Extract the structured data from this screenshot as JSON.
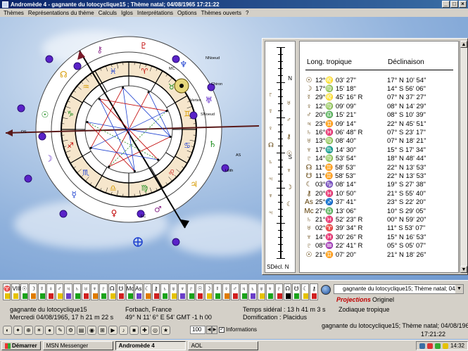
{
  "window": {
    "title": "Andromède 4 - gagnante du lotocyclique15 ; Thème natal; 04/08/1965 17:21:22",
    "buttons": [
      "_",
      "□",
      "×"
    ]
  },
  "menu": [
    "Thèmes",
    "Représentations du thème",
    "Calculs",
    "Iglos",
    "Interprétations",
    "Options",
    "Thèmes ouverts",
    "?"
  ],
  "colors": {
    "accent": "#0a246a",
    "red": "#c00000",
    "blue": "#1c3fd0",
    "purple": "#5a22c8",
    "ink": "#5a3a00"
  },
  "wheel": {
    "chart_labels": [
      "MC",
      "AS",
      "DS",
      "FC",
      "NNoeud",
      "Chiron",
      "Vertex",
      "SNoeud",
      "Lilith"
    ],
    "signs_symbols": [
      "♈",
      "♉",
      "♊",
      "♋",
      "♌",
      "♍",
      "♎",
      "♏",
      "♐",
      "♑",
      "♒",
      "♓"
    ],
    "outer_planets": [
      "♇",
      "♆",
      "♅",
      "♄",
      "♃",
      "♂",
      "♀",
      "☿",
      "☽",
      "☉",
      "☊",
      "⚷"
    ]
  },
  "ruler": {
    "sdecl_label": "SDécl.",
    "n_label": "N",
    "s_label": "S",
    "marks": [
      "♇",
      "♅",
      "☿",
      "♂",
      "♀",
      "⚷",
      "☊",
      "☉",
      "♄",
      "♆",
      "♃",
      "☽",
      "♆",
      "☾",
      "♃"
    ]
  },
  "ephemeris": {
    "header_long": "Long. tropique",
    "header_decl": "Déclinaison",
    "rows": [
      {
        "sym": "☉",
        "lon_deg": "12°",
        "sign": "♌",
        "lon_min": " 03' 27\"",
        "decl": "17° N 10' 54\""
      },
      {
        "sym": "☽",
        "lon_deg": "17°",
        "sign": "♍",
        "lon_min": " 15' 18\"",
        "decl": "14° S 56' 06\""
      },
      {
        "sym": "☿",
        "lon_deg": "29°",
        "sign": "♌",
        "lon_min": " 45' 16\" R",
        "decl": "07° N 37' 27\""
      },
      {
        "sym": "♀",
        "lon_deg": "12°",
        "sign": "♍",
        "lon_min": " 09' 09\"",
        "decl": "08° N 14' 29\""
      },
      {
        "sym": "♂",
        "lon_deg": "20°",
        "sign": "♎",
        "lon_min": " 15' 21\"",
        "decl": "08° S 10' 39\""
      },
      {
        "sym": "♃",
        "lon_deg": "23°",
        "sign": "♊",
        "lon_min": " 09' 14\"",
        "decl": "22° N 45' 51\""
      },
      {
        "sym": "♄",
        "lon_deg": "16°",
        "sign": "♓",
        "lon_min": " 06' 48\" R",
        "decl": "07° S 23' 17\""
      },
      {
        "sym": "♅",
        "lon_deg": "13°",
        "sign": "♍",
        "lon_min": " 08' 40\"",
        "decl": "07° N 18' 21\""
      },
      {
        "sym": "♆",
        "lon_deg": "17°",
        "sign": "♏",
        "lon_min": " 14' 30\"",
        "decl": "15° S 17' 34\""
      },
      {
        "sym": "♇",
        "lon_deg": "14°",
        "sign": "♍",
        "lon_min": " 53' 54\"",
        "decl": "18° N 48' 44\""
      },
      {
        "sym": "☊",
        "lon_deg": "11°",
        "sign": "♊",
        "lon_min": " 58' 53\"",
        "decl": "22° N 13' 53\""
      },
      {
        "sym": "☋",
        "lon_deg": "11°",
        "sign": "♊",
        "lon_min": " 58' 53\"",
        "decl": "22° N 13' 53\""
      },
      {
        "sym": "☾",
        "lon_deg": "03°",
        "sign": "♑",
        "lon_min": " 08' 14\"",
        "decl": "19° S 27' 38\""
      },
      {
        "sym": "⚷",
        "lon_deg": "20°",
        "sign": "♓",
        "lon_min": " 10' 50\"",
        "decl": "21° S 55' 40\""
      },
      {
        "sym": "As",
        "lon_deg": "25°",
        "sign": "♐",
        "lon_min": " 37' 41\"",
        "decl": "23° S 22' 20\""
      },
      {
        "sym": "Mc",
        "lon_deg": "27°",
        "sign": "♎",
        "lon_min": " 13' 06\"",
        "decl": "10° S 29' 05\""
      },
      {
        "sym": "♄",
        "lon_deg": "21°",
        "sign": "♓",
        "lon_min": " 52' 23\" R",
        "decl": "00° N 59' 20\""
      },
      {
        "sym": "♅",
        "lon_deg": "02°",
        "sign": "♈",
        "lon_min": " 39' 34\" R",
        "decl": "11° S 53' 07\""
      },
      {
        "sym": "♆",
        "lon_deg": "14°",
        "sign": "♓",
        "lon_min": " 30' 26\" R",
        "decl": "15° N 16' 53\""
      },
      {
        "sym": "♇",
        "lon_deg": "08°",
        "sign": "♒",
        "lon_min": " 22' 41\" R",
        "decl": "05° S 05' 07\""
      },
      {
        "sym": "☉",
        "lon_deg": "21°",
        "sign": "♊",
        "lon_min": " 07' 20\"",
        "decl": "21° N 18' 26\""
      }
    ]
  },
  "glyph_strip": {
    "cells": [
      "♈",
      "VIII",
      "☉",
      "☽",
      "☿",
      "♀",
      "♂",
      "♃",
      "♄",
      "♅",
      "♆",
      "♇",
      "☊",
      "☋",
      "Mc",
      "As",
      "☾",
      "⚷",
      "♄",
      "♅",
      "♆",
      "♇",
      "☉",
      "☽",
      "☿",
      "♀",
      "♂",
      "♃",
      "♄",
      "♅",
      "♆",
      "♇",
      "☊",
      "☋",
      "☾",
      "⚷"
    ],
    "bar_colors": [
      "#e6c200",
      "#e6c200",
      "#1aa31a",
      "#e07b00",
      "#1aa31a",
      "#d02020",
      "#e6c200",
      "#6a3ec8",
      "#1aa31a",
      "#d02020",
      "#e07b00",
      "#1aa31a",
      "#e6c200",
      "#d02020",
      "#1aa31a",
      "#6a3ec8",
      "#e07b00",
      "#d02020",
      "#1aa31a",
      "#e6c200",
      "#6a3ec8",
      "#1aa31a",
      "#d02020",
      "#e6c200",
      "#1aa31a",
      "#e07b00",
      "#d02020",
      "#1aa31a",
      "#6a3ec8",
      "#e6c200",
      "#1aa31a",
      "#d02020",
      "#000000",
      "#1aa31a",
      "#e6c200",
      "#d02020"
    ]
  },
  "combo": {
    "value": "gagnante du lotocyclique15; Thème natal; 04/08/1"
  },
  "projections_label": "Projections",
  "original_label": "Originel",
  "info": {
    "name": "gagnante du lotocyclique15",
    "datetime": "Mercredi 04/08/1965, 17 h 21 m 22 s",
    "place": "Forbach, France",
    "coords": "49° N 11'   6° E 54' GMT -1 h 00",
    "sidereal": "Temps sidéral : 13 h  41 m   3 s",
    "domification": "Domification : Placidus",
    "zodiac": "Zodiaque tropique"
  },
  "toolbar": {
    "icons": [
      "◐",
      "✦",
      "⊕",
      "☀",
      "●",
      "✎",
      "⚙",
      "▤",
      "◉",
      "⊞",
      "▶",
      "♪",
      "■",
      "✚",
      "◎",
      "★"
    ],
    "zoom": "100",
    "informations_label": "Informations",
    "informations_checked": true
  },
  "status": {
    "line1": "gagnante du lotocyclique15; Thème natal; 04/08/1965",
    "line2": "17:21:22"
  },
  "taskbar": {
    "start": "Démarrer",
    "tasks": [
      "MSN Messenger",
      "Andromède 4",
      "AOL"
    ],
    "active": "Andromède 4",
    "clock": "14:32"
  }
}
